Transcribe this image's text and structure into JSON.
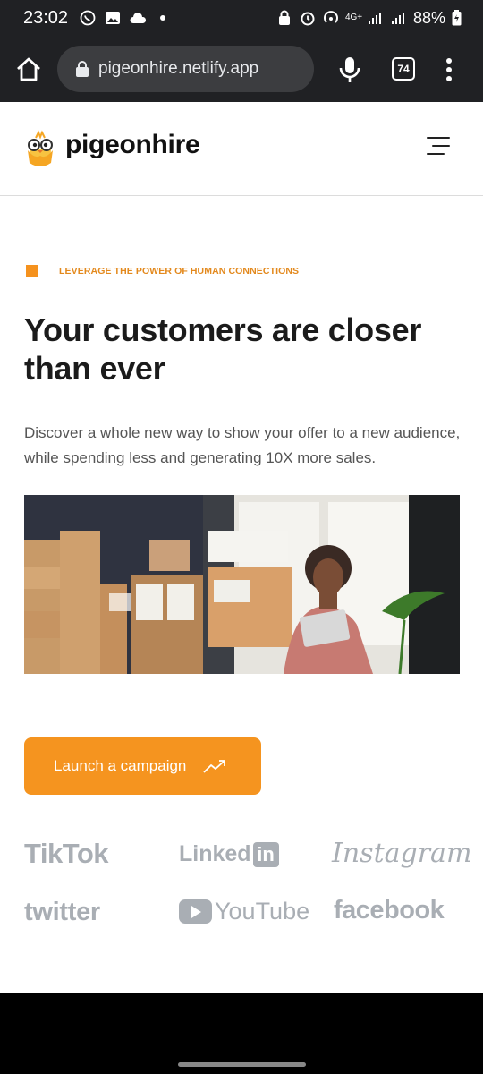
{
  "status_bar": {
    "time": "23:02",
    "left_icons": [
      "whatsapp-icon",
      "image-icon",
      "cloud-icon",
      "dot"
    ],
    "network": "4G+",
    "battery": "88%"
  },
  "browser": {
    "url": "pigeonhire.netlify.app",
    "tab_count": "74"
  },
  "site": {
    "brand_name": "pigeonhire",
    "eyebrow": "LEVERAGE THE POWER OF HUMAN CONNECTIONS",
    "hero_title": "Your customers are closer than ever",
    "hero_subtitle": "Discover a whole new way to show your offer to a new audience, while spending less and generating 10X more sales.",
    "cta_label": "Launch a campaign",
    "brands": {
      "tiktok": "TikTok",
      "linkedin": "Linked",
      "linkedin_box": "in",
      "instagram": "Instagram",
      "twitter": "twitter",
      "youtube": "YouTube",
      "facebook": "facebook"
    }
  },
  "colors": {
    "accent": "#f5941f",
    "brand_gray": "#a9aeb4",
    "chrome_bg": "#202124"
  }
}
